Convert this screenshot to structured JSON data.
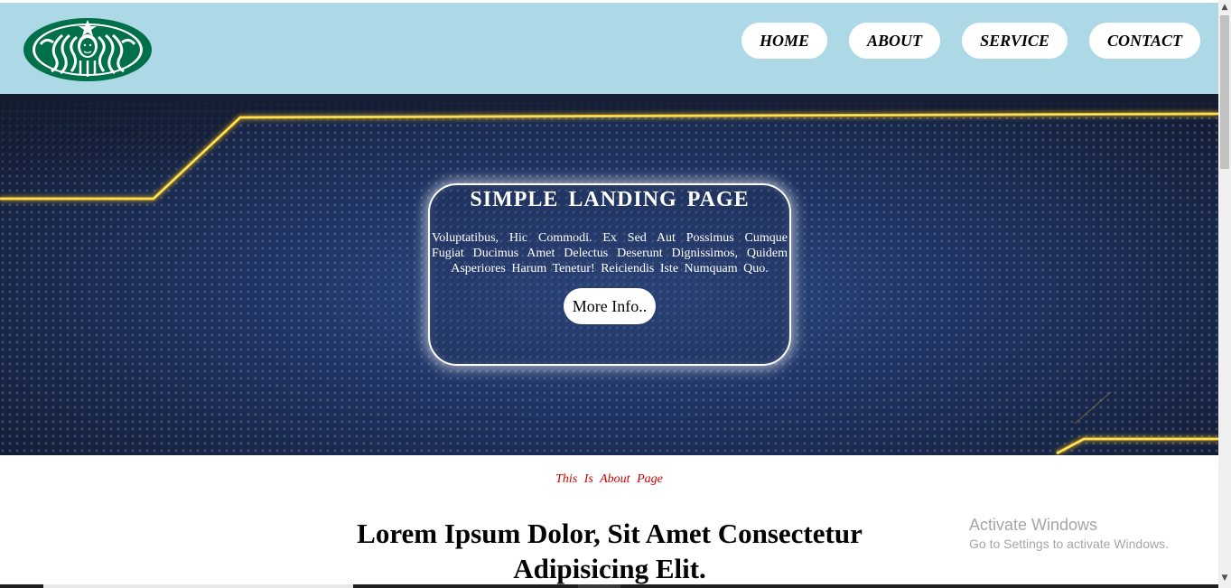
{
  "navbar": {
    "logo_name": "starbucks-logo",
    "items": [
      {
        "label": "HOME"
      },
      {
        "label": "ABOUT"
      },
      {
        "label": "SERVICE"
      },
      {
        "label": "CONTACT"
      }
    ],
    "background": "#add8e6"
  },
  "hero": {
    "title": "SIMPLE LANDING PAGE",
    "text": "Voluptatibus, Hic Commodi. Ex Sed Aut Possimus Cumque Fugiat Ducimus Amet Delectus Deserunt Dignissimos, Quidem Asperiores Harum Tenetur! Reiciendis Iste Numquam Quo.",
    "button_label": "More Info..",
    "accent": "#f5c518"
  },
  "about": {
    "caption": "This Is About Page",
    "heading": "Lorem Ipsum Dolor, Sit Amet Consectetur Adipisicing Elit.",
    "caption_color": "#cc0000"
  },
  "watermark": {
    "title": "Activate Windows",
    "subtitle": "Go to Settings to activate Windows."
  },
  "scrollbar": {
    "up_icon": "▲",
    "down_icon": "▼"
  }
}
